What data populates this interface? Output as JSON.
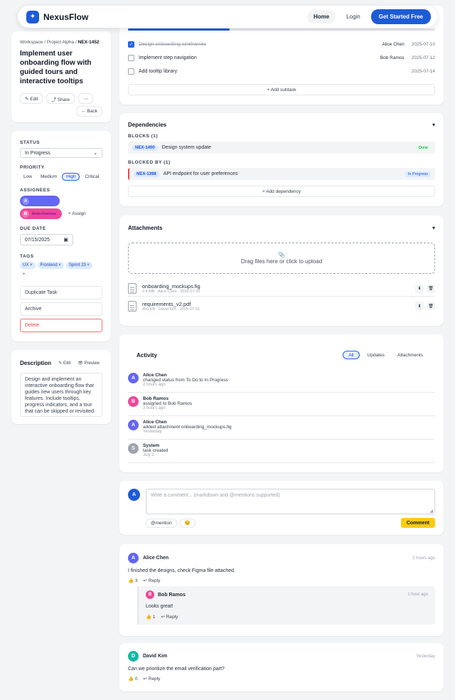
{
  "topbar": {
    "brand": "NexusFlow",
    "logo_icon": "✦",
    "nav_home": "Home",
    "nav_login": "Login",
    "nav_cta": "Get Started Free"
  },
  "task": {
    "breadcrumb": {
      "workspace": "Workspace",
      "project": "Project Alpha",
      "id": "NEX-1452"
    },
    "title": "Implement user onboarding flow with guided tours and interactive tooltips",
    "edit_label": "✎ Edit",
    "share_label": "⤴ Share",
    "more_label": "⋯",
    "back_label": "← Back"
  },
  "props": {
    "status_label": "STATUS",
    "status_value": "In Progress",
    "priority_label": "PRIORITY",
    "priorities": [
      "Low",
      "Medium",
      "High",
      "Critical"
    ],
    "priority_selected": "High",
    "assignees_label": "ASSIGNEES",
    "assignees": [
      {
        "initial": "A",
        "color": "#6366f1"
      },
      {
        "initial": "B",
        "name": "Bob Ramos",
        "color": "#ec4899"
      }
    ],
    "assign_label": "+ Assign",
    "due_label": "DUE DATE",
    "due_value": "07/15/2025",
    "tags_label": "TAGS",
    "tags": [
      {
        "text": "UX",
        "close": "×"
      },
      {
        "text": "Frontend",
        "close": "×"
      },
      {
        "text": "Sprint 23",
        "close": "×"
      }
    ],
    "add_tag": "+",
    "duplicate_label": "Duplicate Task",
    "archive_label": "Archive",
    "delete_label": "Delete"
  },
  "description": {
    "title": "Description",
    "edit_label": "✎ Edit",
    "preview_label": "👁 Preview",
    "text": "Design and implement an interactive onboarding flow that guides new users through key features. Include tooltips, progress indicators, and a tour that can be skipped or revisited."
  },
  "subtasks": {
    "progress": 0.33,
    "items": [
      {
        "title": "Design onboarding wireframes",
        "assignee": "Alice Chen",
        "date": "2025-07-10",
        "done": true
      },
      {
        "title": "Implement step navigation",
        "assignee": "Bob Ramos",
        "date": "2025-07-12",
        "done": false
      },
      {
        "title": "Add tooltip library",
        "assignee": "",
        "date": "2025-07-14",
        "done": false
      }
    ],
    "add_label": "+ Add subtask"
  },
  "dependencies": {
    "title": "Dependencies",
    "blocks_label": "BLOCKS (1)",
    "blocks": {
      "id": "NEX-1400",
      "title": "Design system update",
      "status": "Done"
    },
    "blocked_by_label": "BLOCKED BY (1)",
    "blocked_by": {
      "id": "NEX-1398",
      "title": "API endpoint for user preferences",
      "status": "In Progress"
    },
    "add_label": "+ Add dependency"
  },
  "attachments": {
    "title": "Attachments",
    "upload_icon": "📎",
    "upload_label": "Drag files here or click to upload",
    "files": [
      {
        "name": "onboarding_mockups.fig",
        "meta": "2.4 MB · Alice Chen · 2025-07-02"
      },
      {
        "name": "requirements_v2.pdf",
        "meta": "450 KB · David Kim · 2025-07-01"
      }
    ],
    "download_icon": "⬇",
    "delete_icon": "🗑"
  },
  "activity": {
    "title": "Activity",
    "tabs": [
      "All",
      "Updates",
      "Attachments"
    ],
    "items": [
      {
        "initial": "A",
        "color": "#6366f1",
        "name": "Alice Chen",
        "text": "changed status from To Do to In Progress",
        "time": "2 hours ago"
      },
      {
        "initial": "B",
        "color": "#ec4899",
        "name": "Bob Ramos",
        "text": "assigned to Bob Ramos",
        "time": "3 hours ago"
      },
      {
        "initial": "A",
        "color": "#6366f1",
        "name": "Alice Chen",
        "text": "added attachment onboarding_mockups.fig",
        "time": "Yesterday"
      },
      {
        "initial": "S",
        "color": "#9ca3af",
        "name": "System",
        "text": "task created",
        "time": "July 1"
      }
    ]
  },
  "composer": {
    "avatar": "A",
    "placeholder": "Write a comment... (markdown and @mentions supported)",
    "mention_label": "@mention",
    "emoji_label": "😊",
    "submit_label": "Comment"
  },
  "comments": [
    {
      "initial": "A",
      "color": "#6366f1",
      "name": "Alice Chen",
      "time": "2 hours ago",
      "text": "I finished the designs, check Figma file attached.",
      "likes": "👍 3",
      "reply": "↩ Reply",
      "reply_item": {
        "initial": "B",
        "color": "#ec4899",
        "name": "Bob Ramos",
        "time": "1 hour ago",
        "text": "Looks great!",
        "likes": "👍 1",
        "reply": "↩ Reply"
      }
    },
    {
      "initial": "D",
      "color": "#14b8a6",
      "name": "David Kim",
      "time": "Yesterday",
      "text": "Can we prioritize the email verification part?",
      "likes": "👍 0",
      "reply": "↩ Reply"
    }
  ]
}
